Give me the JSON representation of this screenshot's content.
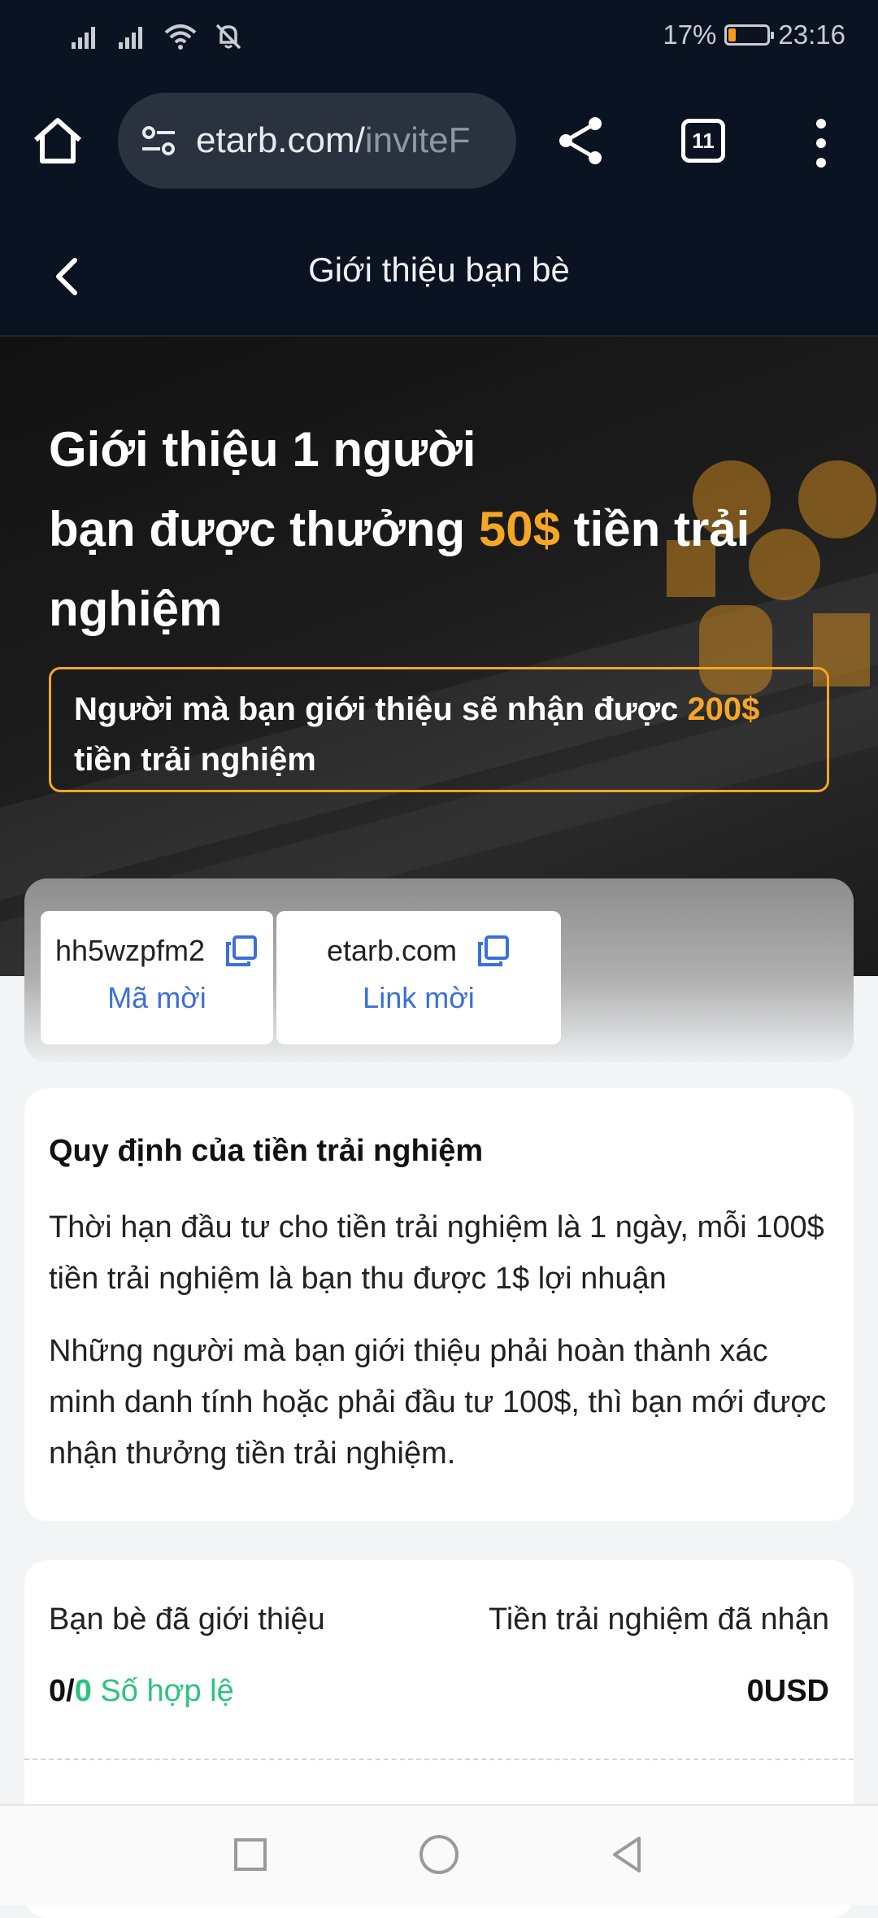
{
  "status_bar": {
    "battery": "17%",
    "battery_level": 0.17,
    "time": "23:16"
  },
  "browser": {
    "url_host": "etarb.com/",
    "url_path": "inviteF",
    "tab_count": "11"
  },
  "header": {
    "title": "Giới thiệu bạn bè"
  },
  "hero": {
    "line1": "Giới thiệu 1 người",
    "line2_pre": "bạn được thưởng ",
    "amount": "50$",
    "line2_post": " tiền trải",
    "line3": "nghiệm",
    "box_pre": "Người mà bạn giới thiệu sẽ nhận được ",
    "box_amount": "200$",
    "box_post": "tiền trải nghiệm"
  },
  "invite": {
    "code_value": "hh5wzpfm2",
    "code_label": "Mã mời",
    "link_value": "etarb.com",
    "link_label": "Link mời"
  },
  "rules": {
    "title": "Quy định của tiền trải nghiệm",
    "p1": "Thời hạn đầu tư cho tiền trải nghiệm là 1 ngày, mỗi 100$ tiền trải nghiệm là bạn thu được 1$ lợi nhuận",
    "p2": "Những người mà bạn giới thiệu phải hoàn thành xác minh danh tính hoặc phải đầu tư 100$, thì bạn mới được nhận thưởng tiền trải nghiệm."
  },
  "stats": {
    "friends_label": "Bạn bè đã giới thiệu",
    "received_label": "Tiền trải nghiệm đã nhận",
    "friends_count": "0/",
    "valid_count": "0",
    "valid_label": " Số hợp lệ",
    "received_value": "0USD"
  },
  "colors": {
    "accent": "#f5a623",
    "link": "#3b6fd9",
    "valid": "#2ec27e",
    "dark_bg": "#0a1322"
  }
}
